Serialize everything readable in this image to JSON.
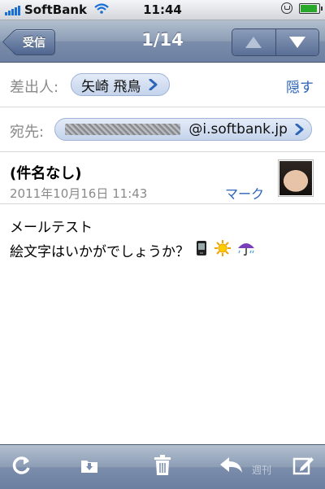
{
  "status": {
    "carrier": "SoftBank",
    "time": "11:44"
  },
  "nav": {
    "back_label": "受信",
    "title": "1/14"
  },
  "header": {
    "from_label": "差出人:",
    "from_name": "矢崎 飛鳥",
    "hide_label": "隠す",
    "to_label": "宛先:",
    "to_address_suffix": "@i.softbank.jp"
  },
  "message": {
    "subject": "(件名なし)",
    "date": "2011年10月16日 11:43",
    "mark_label": "マーク",
    "body_line1": "メールテスト",
    "body_line2": "絵文字はいかがでしょうか？"
  },
  "toolbar": {
    "watermark": "週刊"
  },
  "colors": {
    "accent_link": "#2c64b8",
    "nav_bar": "#7b8dab",
    "signal": "#1a6ed8",
    "battery": "#2aa82a"
  },
  "icons": [
    "signal-icon",
    "wifi-icon",
    "rotation-lock-icon",
    "battery-icon",
    "up-arrow-icon",
    "down-arrow-icon",
    "chevron-right-icon",
    "phone-emoji-icon",
    "sun-emoji-icon",
    "umbrella-emoji-icon",
    "refresh-icon",
    "move-folder-icon",
    "trash-icon",
    "reply-icon",
    "compose-icon"
  ]
}
